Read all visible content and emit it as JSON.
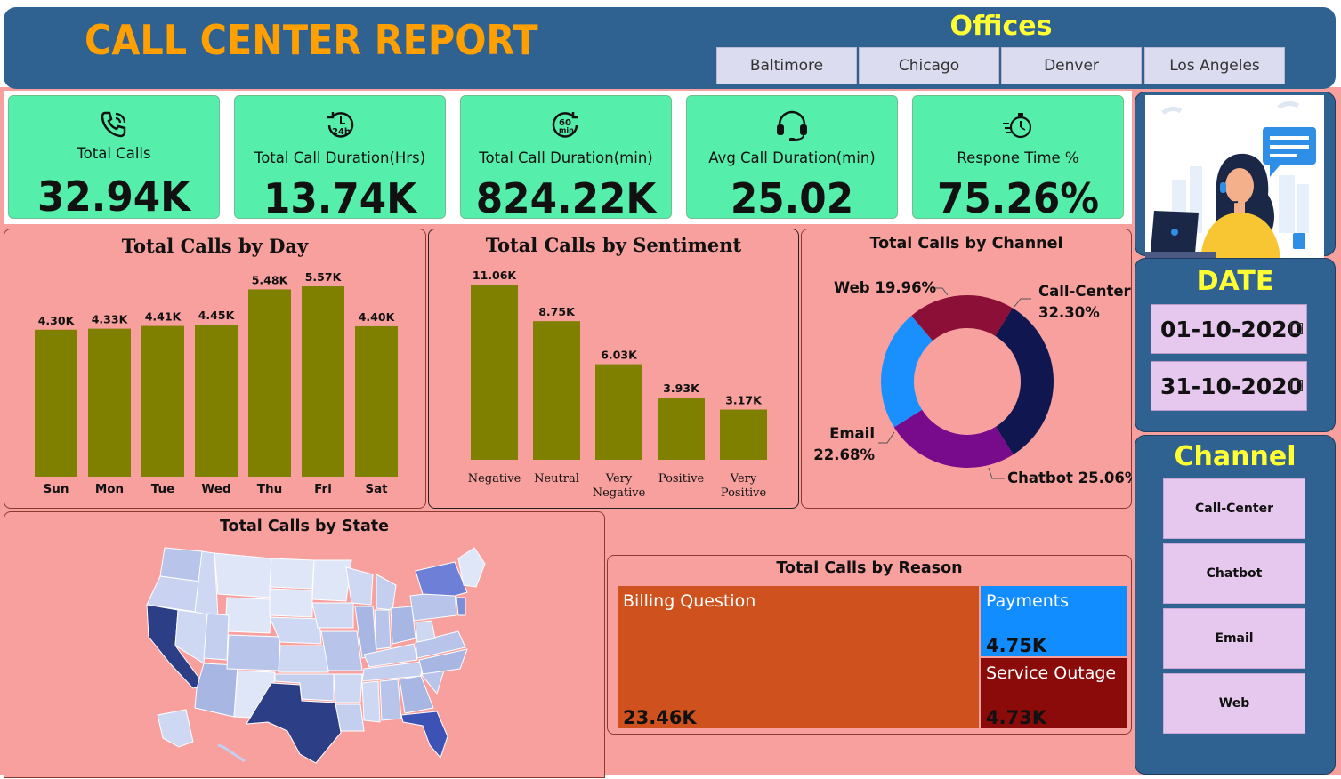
{
  "header": {
    "title": "CALL CENTER REPORT",
    "offices_label": "Offices",
    "offices": [
      "Baltimore",
      "Chicago",
      "Denver",
      "Los Angeles"
    ]
  },
  "kpis": [
    {
      "label": "Total Calls",
      "value": "32.94K",
      "icon": "phone-icon"
    },
    {
      "label": "Total Call Duration(Hrs)",
      "value": "13.74K",
      "icon": "24h-clock-icon"
    },
    {
      "label": "Total Call Duration(min)",
      "value": "824.22K",
      "icon": "60min-timer-icon"
    },
    {
      "label": "Avg Call Duration(min)",
      "value": "25.02",
      "icon": "headset-icon"
    },
    {
      "label": "Respone Time %",
      "value": "75.26%",
      "icon": "stopwatch-icon"
    }
  ],
  "side": {
    "date_label": "DATE",
    "date_from": "01-10-2020",
    "date_to": "31-10-2020",
    "channel_label": "Channel",
    "channels": [
      "Call-Center",
      "Chatbot",
      "Email",
      "Web"
    ]
  },
  "colors": {
    "header_bg": "#2f6291",
    "title": "#ff9f00",
    "accent_yellow": "#ffff33",
    "kpi_bg": "#55eeab",
    "panel_bg": "#f7a09e",
    "bar": "#808000",
    "donut": [
      "#0f1650",
      "#780a8c",
      "#1a90ff",
      "#8b0f36"
    ],
    "treemap": [
      "#cf521e",
      "#118dff",
      "#8b0a0a"
    ]
  },
  "chart_data": [
    {
      "id": "by-day",
      "type": "bar",
      "title": "Total Calls by Day",
      "categories": [
        "Sun",
        "Mon",
        "Tue",
        "Wed",
        "Thu",
        "Fri",
        "Sat"
      ],
      "values": [
        4.3,
        4.33,
        4.41,
        4.45,
        5.48,
        5.57,
        4.4
      ],
      "labels": [
        "4.30K",
        "4.33K",
        "4.41K",
        "4.45K",
        "5.48K",
        "5.57K",
        "4.40K"
      ],
      "grid": false
    },
    {
      "id": "by-sentiment",
      "type": "bar",
      "title": "Total Calls by Sentiment",
      "categories": [
        "Negative",
        "Neutral",
        "Very Negative",
        "Positive",
        "Very Positive"
      ],
      "values": [
        11.06,
        8.75,
        6.03,
        3.93,
        3.17
      ],
      "labels": [
        "11.06K",
        "8.75K",
        "6.03K",
        "3.93K",
        "3.17K"
      ],
      "grid": false
    },
    {
      "id": "by-channel",
      "type": "pie",
      "title": "Total Calls by Channel",
      "categories": [
        "Call-Center",
        "Chatbot",
        "Email",
        "Web"
      ],
      "values": [
        32.3,
        25.06,
        22.68,
        19.96
      ],
      "labels": [
        "Call-Center 32.30%",
        "Chatbot 25.06%",
        "Email 22.68%",
        "Web 19.96%"
      ]
    },
    {
      "id": "by-reason",
      "type": "table",
      "title": "Total Calls by Reason",
      "categories": [
        "Billing Question",
        "Payments",
        "Service Outage"
      ],
      "values": [
        23.46,
        4.75,
        4.73
      ],
      "labels": [
        "23.46K",
        "4.75K",
        "4.73K"
      ]
    },
    {
      "id": "by-state",
      "type": "heatmap",
      "title": "Total Calls by State"
    }
  ]
}
